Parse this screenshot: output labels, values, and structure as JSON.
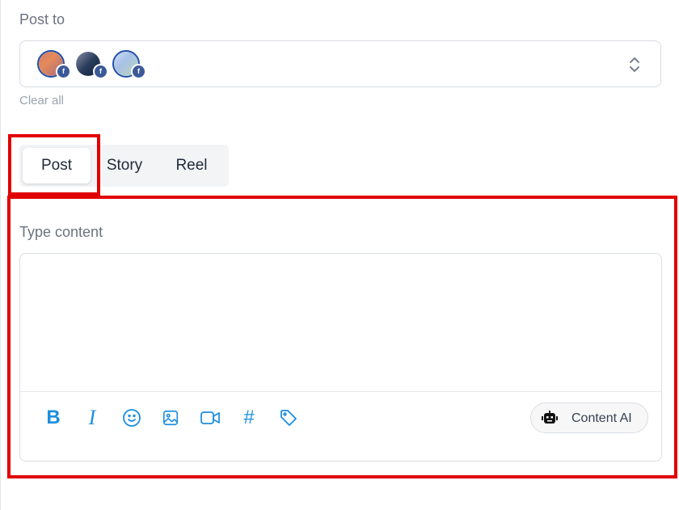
{
  "post_to": {
    "label": "Post to",
    "accounts": [
      {
        "name": "account-1",
        "badge": "f"
      },
      {
        "name": "account-2",
        "badge": "f"
      },
      {
        "name": "account-3",
        "badge": "f"
      }
    ],
    "clear_label": "Clear all"
  },
  "tabs": [
    {
      "label": "Post",
      "active": true
    },
    {
      "label": "Story",
      "active": false
    },
    {
      "label": "Reel",
      "active": false
    }
  ],
  "content": {
    "label": "Type content",
    "value": "",
    "toolbar": {
      "bold": "B",
      "italic": "I",
      "hashtag": "#",
      "icons": [
        "bold-icon",
        "italic-icon",
        "emoji-icon",
        "image-icon",
        "video-icon",
        "hashtag-icon",
        "tag-icon"
      ]
    },
    "ai_button_label": "Content AI"
  },
  "colors": {
    "accent": "#1d8fe0",
    "highlight": "#e10000",
    "facebook": "#3b5998"
  }
}
